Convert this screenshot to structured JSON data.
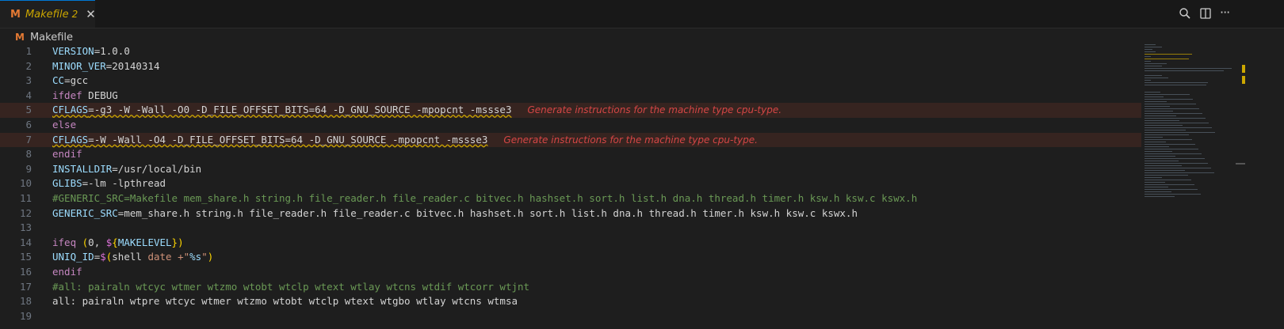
{
  "tab": {
    "title": "Makefile",
    "badge": "2",
    "close_glyph": "✕",
    "icon_glyph": "M"
  },
  "toolbar": {
    "search_icon": "search-icon",
    "split_icon": "split-editor-icon",
    "more_glyph": "···"
  },
  "breadcrumb": {
    "icon_glyph": "M",
    "label": "Makefile"
  },
  "editor": {
    "diagnostic": "Generate instructions for the machine type cpu-type.",
    "lines": [
      {
        "n": "1",
        "t": "VERSION=1.0.0"
      },
      {
        "n": "2",
        "t": "MINOR_VER=20140314"
      },
      {
        "n": "3",
        "t": "CC=gcc"
      },
      {
        "n": "4",
        "t": "ifdef DEBUG"
      },
      {
        "n": "5",
        "t": "CFLAGS=-g3 -W -Wall -O0 -D_FILE_OFFSET_BITS=64 -D_GNU_SOURCE -mpopcnt -mssse3"
      },
      {
        "n": "6",
        "t": "else"
      },
      {
        "n": "7",
        "t": "CFLAGS=-W -Wall -O4 -D_FILE_OFFSET_BITS=64 -D_GNU_SOURCE -mpopcnt -mssse3"
      },
      {
        "n": "8",
        "t": "endif"
      },
      {
        "n": "9",
        "t": "INSTALLDIR=/usr/local/bin"
      },
      {
        "n": "10",
        "t": "GLIBS=-lm -lpthread"
      },
      {
        "n": "11",
        "t": "#GENERIC_SRC=Makefile mem_share.h string.h file_reader.h file_reader.c bitvec.h hashset.h sort.h list.h dna.h thread.h timer.h ksw.h ksw.c kswx.h"
      },
      {
        "n": "12",
        "t": "GENERIC_SRC=mem_share.h string.h file_reader.h file_reader.c bitvec.h hashset.h sort.h list.h dna.h thread.h timer.h ksw.h ksw.c kswx.h"
      },
      {
        "n": "13",
        "t": ""
      },
      {
        "n": "14",
        "t": "ifeq (0, ${MAKELEVEL})"
      },
      {
        "n": "15",
        "t": "UNIQ_ID=$(shell date +\"%s\")"
      },
      {
        "n": "16",
        "t": "endif"
      },
      {
        "n": "17",
        "t": "#all: pairaln wtcyc wtmer wtzmo wtobt wtclp wtext wtlay wtcns wtdif wtcorr wtjnt"
      },
      {
        "n": "18",
        "t": "all: pairaln wtpre wtcyc wtmer wtzmo wtobt wtclp wtext wtgbo wtlay wtcns wtmsa"
      },
      {
        "n": "19",
        "t": ""
      }
    ]
  },
  "colors": {
    "accent": "#0078d4",
    "warning": "#cca700",
    "error": "#f14c4c",
    "comment": "#6a9955"
  }
}
